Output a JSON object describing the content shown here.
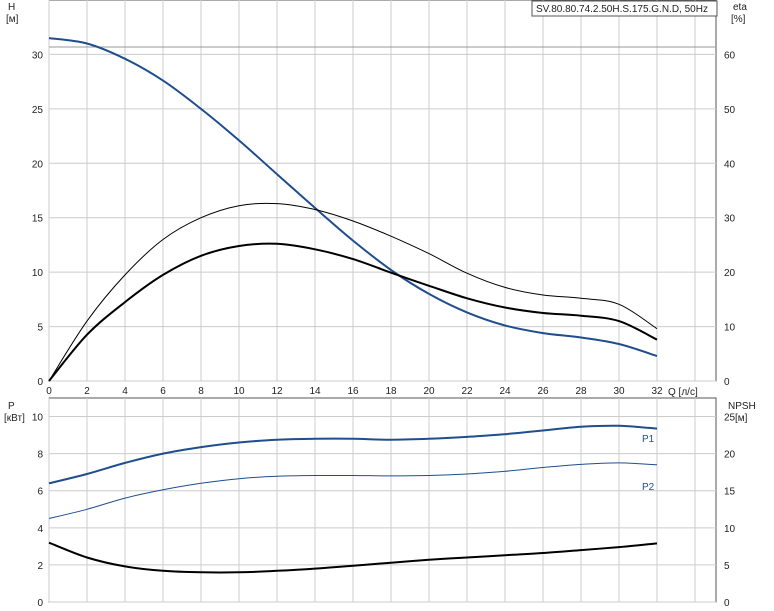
{
  "model_label": "SV.80.80.74.2.50H.S.175.G.N.D, 50Hz",
  "colors": {
    "grid": "#cccccc",
    "axis": "#555555",
    "blue": "#1f4e8c",
    "black": "#000000"
  },
  "chart_data": [
    {
      "type": "line",
      "x_axis": {
        "label": "Q [л/с]",
        "range": [
          0,
          32
        ],
        "ticks": [
          0,
          2,
          4,
          6,
          8,
          10,
          12,
          14,
          16,
          18,
          20,
          22,
          24,
          26,
          28,
          30,
          32
        ]
      },
      "y_left": {
        "label_top": "H",
        "label_unit": "[м]",
        "range": [
          0,
          35
        ],
        "ticks": [
          0,
          5,
          10,
          15,
          20,
          25,
          30
        ]
      },
      "y_right": {
        "label_top": "eta",
        "label_unit": "[%]",
        "range": [
          0,
          70
        ],
        "ticks": [
          0,
          10,
          20,
          30,
          40,
          50,
          60
        ]
      },
      "grid": true,
      "series": [
        {
          "key": "H",
          "axis": "left",
          "color": "#1f4e8c",
          "stroke": 2,
          "x": [
            0,
            2,
            4,
            6,
            8,
            10,
            12,
            14,
            16,
            18,
            20,
            22,
            24,
            26,
            28,
            30,
            32
          ],
          "y": [
            31.5,
            31.0,
            29.6,
            27.6,
            25.0,
            22.1,
            19.0,
            15.9,
            12.9,
            10.2,
            8.0,
            6.3,
            5.1,
            4.4,
            4.0,
            3.4,
            2.3
          ]
        },
        {
          "key": "eta_1",
          "axis": "right",
          "color": "#000000",
          "stroke": 1,
          "x": [
            0,
            2,
            4,
            6,
            8,
            10,
            12,
            14,
            16,
            18,
            20,
            22,
            24,
            26,
            28,
            30,
            32
          ],
          "y": [
            0,
            11,
            19.5,
            26,
            30,
            32.2,
            32.6,
            31.5,
            29.4,
            26.6,
            23.4,
            19.8,
            17.2,
            15.8,
            15.2,
            14.1,
            9.6
          ]
        },
        {
          "key": "eta_2",
          "axis": "right",
          "color": "#000000",
          "stroke": 2,
          "x": [
            0,
            2,
            4,
            6,
            8,
            10,
            12,
            14,
            16,
            18,
            20,
            22,
            24,
            26,
            28,
            30,
            32
          ],
          "y": [
            0,
            8.5,
            14.5,
            19.5,
            23,
            24.8,
            25.2,
            24.2,
            22.4,
            19.9,
            17.5,
            15.2,
            13.5,
            12.5,
            12.0,
            11.0,
            7.6
          ]
        }
      ]
    },
    {
      "type": "line",
      "x_axis": {
        "range": [
          0,
          32
        ]
      },
      "y_left": {
        "label_top": "P",
        "label_unit": "[кВт]",
        "range": [
          0,
          11
        ],
        "ticks": [
          0,
          2,
          4,
          6,
          8,
          10
        ]
      },
      "y_right": {
        "label_top": "NPSH",
        "label_unit": "[м]",
        "range": [
          0,
          27.5
        ],
        "ticks": [
          0,
          5,
          10,
          15,
          20,
          25
        ]
      },
      "grid": true,
      "series": [
        {
          "name": "P1",
          "axis": "left",
          "color": "#1f4e8c",
          "stroke": 2,
          "x": [
            0,
            2,
            4,
            6,
            8,
            10,
            12,
            14,
            16,
            18,
            20,
            22,
            24,
            26,
            28,
            30,
            32
          ],
          "y": [
            6.4,
            6.9,
            7.5,
            8.0,
            8.35,
            8.6,
            8.75,
            8.8,
            8.8,
            8.75,
            8.8,
            8.9,
            9.05,
            9.25,
            9.45,
            9.5,
            9.35
          ]
        },
        {
          "name": "P2",
          "axis": "left",
          "color": "#1f4e8c",
          "stroke": 1,
          "x": [
            0,
            2,
            4,
            6,
            8,
            10,
            12,
            14,
            16,
            18,
            20,
            22,
            24,
            26,
            28,
            30,
            32
          ],
          "y": [
            4.5,
            5.0,
            5.6,
            6.05,
            6.4,
            6.65,
            6.78,
            6.82,
            6.82,
            6.8,
            6.82,
            6.9,
            7.05,
            7.25,
            7.42,
            7.5,
            7.4
          ]
        },
        {
          "key": "NPSH",
          "axis": "right",
          "color": "#000000",
          "stroke": 2,
          "x": [
            0,
            2,
            4,
            6,
            8,
            10,
            12,
            14,
            16,
            18,
            20,
            22,
            24,
            26,
            28,
            30,
            32
          ],
          "y": [
            8.0,
            6.0,
            4.8,
            4.2,
            4.0,
            4.0,
            4.2,
            4.5,
            4.9,
            5.3,
            5.7,
            6.0,
            6.3,
            6.6,
            7.0,
            7.4,
            7.9
          ]
        }
      ]
    }
  ]
}
